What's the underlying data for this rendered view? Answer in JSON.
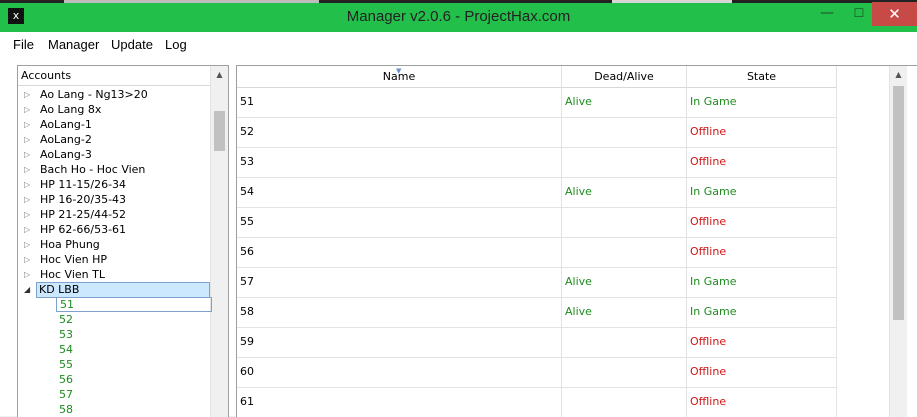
{
  "window": {
    "title": "Manager v2.0.6 - ProjectHax.com",
    "app_icon": "terminal-icon",
    "minimize": "—",
    "maximize": "☐",
    "close": "✕"
  },
  "menu": [
    "File",
    "Manager",
    "Update",
    "Log"
  ],
  "tree": {
    "header": "Accounts",
    "collapsed_glyph": "▷",
    "expanded_glyph": "◢",
    "scroll_up": "▲",
    "nodes": [
      "Ao Lang - Ng13>20",
      "Ao Lang 8x",
      "AoLang-1",
      "AoLang-2",
      "AoLang-3",
      "Bach Ho - Hoc Vien",
      "HP 11-15/26-34",
      "HP 16-20/35-43",
      "HP 21-25/44-52",
      "HP 62-66/53-61",
      "Hoa Phung",
      "Hoc Vien HP",
      "Hoc Vien TL"
    ],
    "expanded_node": {
      "label": "KD LBB",
      "children": [
        "51",
        "52",
        "53",
        "54",
        "55",
        "56",
        "57",
        "58"
      ]
    }
  },
  "grid": {
    "columns": {
      "name": "Name",
      "dead_alive": "Dead/Alive",
      "state": "State"
    },
    "sort_mark": "▼",
    "scroll_up": "▲",
    "rows": [
      {
        "name": "51",
        "dead_alive": "Alive",
        "state": "In Game",
        "status": "green"
      },
      {
        "name": "52",
        "dead_alive": "",
        "state": "Offline",
        "status": "red"
      },
      {
        "name": "53",
        "dead_alive": "",
        "state": "Offline",
        "status": "red"
      },
      {
        "name": "54",
        "dead_alive": "Alive",
        "state": "In Game",
        "status": "green"
      },
      {
        "name": "55",
        "dead_alive": "",
        "state": "Offline",
        "status": "red"
      },
      {
        "name": "56",
        "dead_alive": "",
        "state": "Offline",
        "status": "red"
      },
      {
        "name": "57",
        "dead_alive": "Alive",
        "state": "In Game",
        "status": "green"
      },
      {
        "name": "58",
        "dead_alive": "Alive",
        "state": "In Game",
        "status": "green"
      },
      {
        "name": "59",
        "dead_alive": "",
        "state": "Offline",
        "status": "red"
      },
      {
        "name": "60",
        "dead_alive": "",
        "state": "Offline",
        "status": "red"
      },
      {
        "name": "61",
        "dead_alive": "",
        "state": "Offline",
        "status": "red"
      }
    ]
  },
  "colors": {
    "titlebar": "#22c04a",
    "online": "#1f8b1f",
    "offline": "#d21515",
    "selection": "#cce8ff"
  }
}
